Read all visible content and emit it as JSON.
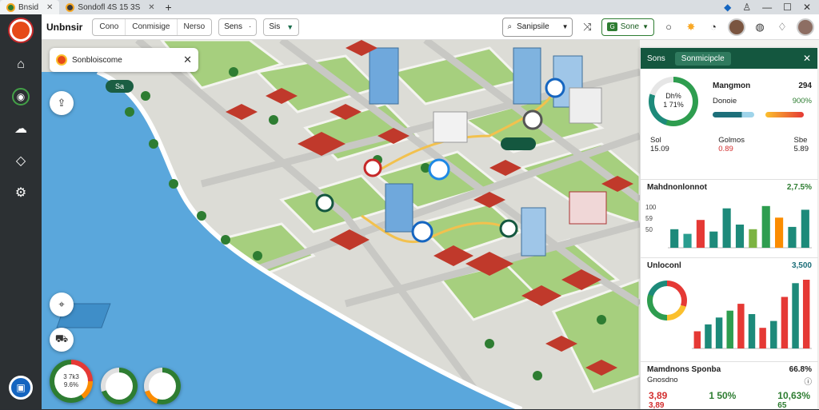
{
  "browser": {
    "tabs": [
      {
        "label": "Bnsid"
      },
      {
        "label": "Sondofl 4S 15 3S"
      }
    ],
    "new_tab": "+",
    "window_controls": [
      "—",
      "☐",
      "✕"
    ]
  },
  "toolbar": {
    "app_title": "Unbnsir",
    "segments": [
      "Cono",
      "Conmisige",
      "Nerso"
    ],
    "dropdown1": {
      "label": "Sens",
      "value": "·"
    },
    "dropdown2": {
      "label": "Sis"
    },
    "search": {
      "label": "Sanipsile"
    },
    "view_button": {
      "label": "Sone",
      "badge": "G"
    }
  },
  "map": {
    "search_card": {
      "text": "Sonbloiscome"
    },
    "chip": "Sa",
    "gauges": [
      {
        "value": "3 7k3",
        "sub": "9.6%"
      },
      {
        "value": "",
        "sub": ""
      },
      {
        "value": "",
        "sub": ""
      }
    ],
    "colors": {
      "water": "#5aa7dc",
      "grass": "#a6cf7e",
      "road": "#c8c8c4",
      "roof_red": "#c0392b",
      "accent": "#14573f"
    }
  },
  "panel": {
    "header": {
      "tab1": "Sons",
      "tab2": "Sonmicipcle"
    },
    "summary": {
      "donut_label": "Dh%",
      "donut_sub": "1 71%",
      "metric1": {
        "label": "Mangmon",
        "value": "294"
      },
      "metric2": {
        "label": "Donoie",
        "value": "900%"
      },
      "stats": [
        {
          "label": "Sol",
          "value": "15.09"
        },
        {
          "label": "Golmos",
          "value": "0.89"
        },
        {
          "label": "Sbe",
          "value": "5.89"
        }
      ]
    },
    "chart1": {
      "title": "Mahdnonlonnot",
      "value": "2,7.5%",
      "y_ticks": [
        "100",
        "59",
        "50"
      ],
      "bars": [
        {
          "v": 0.4,
          "c": "#1d8a7a"
        },
        {
          "v": 0.3,
          "c": "#2a9d8f"
        },
        {
          "v": 0.6,
          "c": "#e53935"
        },
        {
          "v": 0.35,
          "c": "#1d8a7a"
        },
        {
          "v": 0.85,
          "c": "#1d8a7a"
        },
        {
          "v": 0.5,
          "c": "#1d8a7a"
        },
        {
          "v": 0.4,
          "c": "#7cb342"
        },
        {
          "v": 0.9,
          "c": "#2e9d4f"
        },
        {
          "v": 0.65,
          "c": "#fb8c00"
        },
        {
          "v": 0.45,
          "c": "#1d8a7a"
        },
        {
          "v": 0.82,
          "c": "#1d8a7a"
        }
      ]
    },
    "chart2": {
      "title": "Unloconl",
      "value": "3,500",
      "bars": [
        {
          "v": 0.25,
          "c": "#e53935"
        },
        {
          "v": 0.35,
          "c": "#1d8a7a"
        },
        {
          "v": 0.45,
          "c": "#1d8a7a"
        },
        {
          "v": 0.55,
          "c": "#2e9d4f"
        },
        {
          "v": 0.65,
          "c": "#e53935"
        },
        {
          "v": 0.5,
          "c": "#1d8a7a"
        },
        {
          "v": 0.3,
          "c": "#e53935"
        },
        {
          "v": 0.4,
          "c": "#1d8a7a"
        },
        {
          "v": 0.75,
          "c": "#e53935"
        },
        {
          "v": 0.95,
          "c": "#1d8a7a"
        },
        {
          "v": 1.0,
          "c": "#e53935"
        }
      ]
    },
    "footer": {
      "title": "Mamdnons Sponba",
      "value": "66.8%",
      "sub": "Gnosdno",
      "stats": [
        {
          "value": "3,89",
          "sub": "3,89",
          "color": "#d32f2f"
        },
        {
          "value": "1 50%",
          "sub": "",
          "color": "#2e7d32"
        },
        {
          "value": "10,63%",
          "sub": "65",
          "color": "#2e7d32"
        }
      ]
    }
  }
}
